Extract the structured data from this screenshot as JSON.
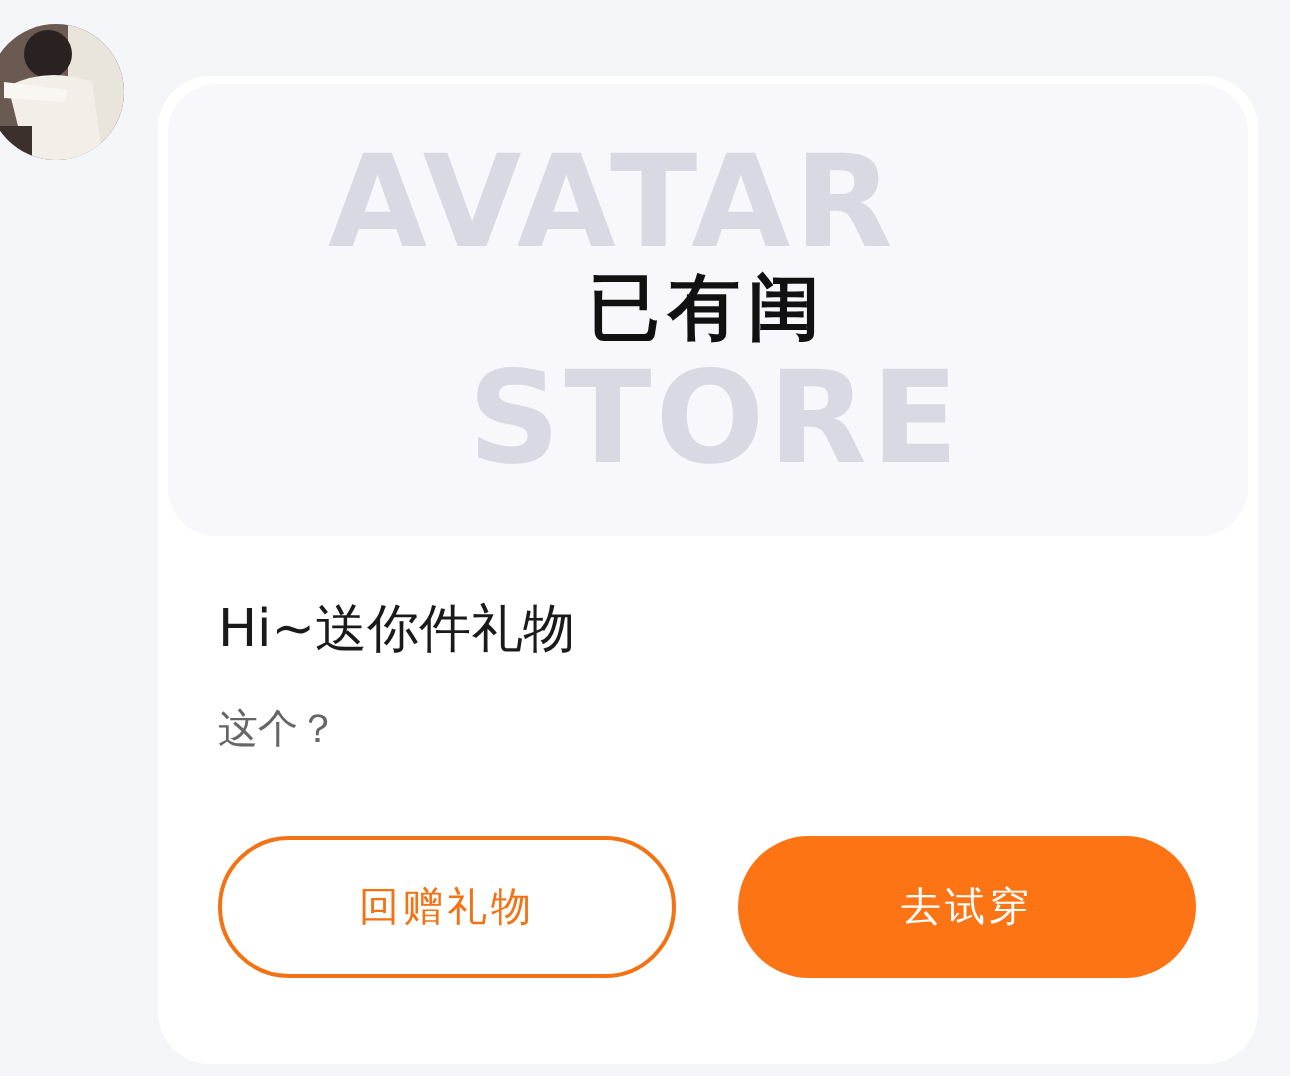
{
  "banner": {
    "backdrop_words": [
      "AVATAR",
      "STORE"
    ],
    "title": "已有闺"
  },
  "message": {
    "title": "Hi~送你件礼物",
    "subtitle": "这个？"
  },
  "buttons": [
    {
      "label": "回赠礼物",
      "kind": "outline"
    },
    {
      "label": "去试穿",
      "kind": "primary"
    }
  ]
}
